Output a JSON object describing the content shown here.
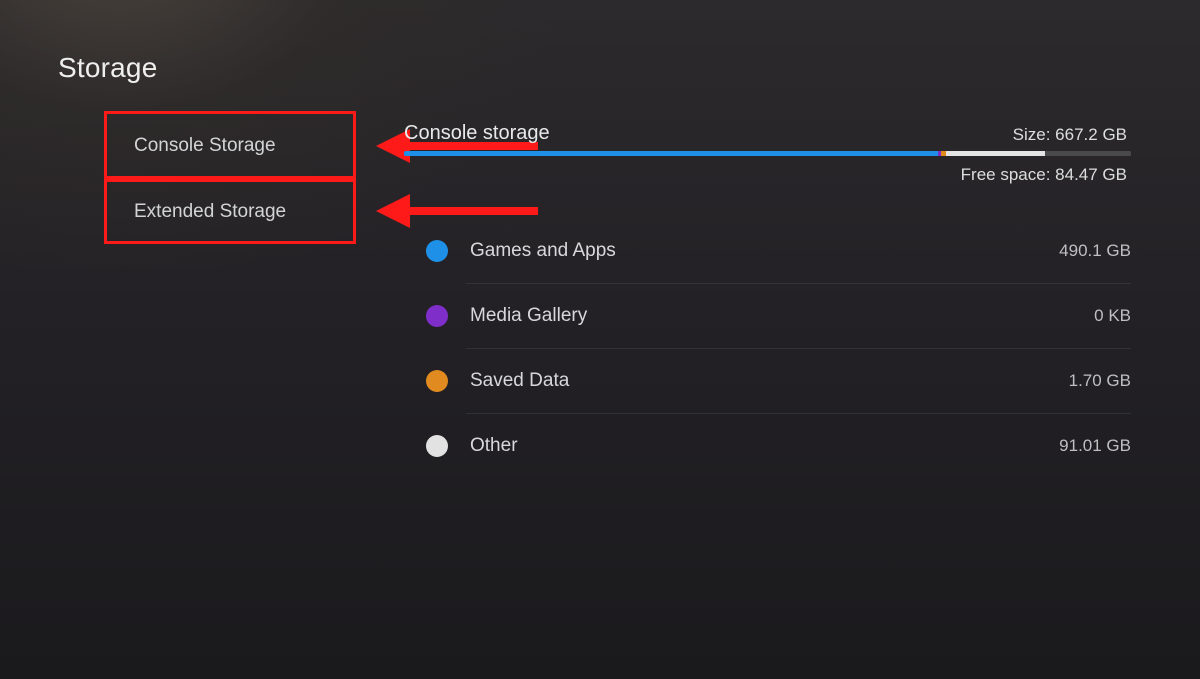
{
  "title": "Storage",
  "menu": {
    "console": "Console Storage",
    "extended": "Extended Storage"
  },
  "pane": {
    "heading": "Console storage",
    "size_label": "Size: 667.2 GB",
    "free_label": "Free space: 84.47 GB"
  },
  "bar": {
    "games_pct": 73.5,
    "media_pct": 0.3,
    "saved_pct": 0.8,
    "other_pct": 13.6,
    "free_pct": 11.8
  },
  "categories": {
    "games": {
      "label": "Games and Apps",
      "value": "490.1 GB"
    },
    "media": {
      "label": "Media Gallery",
      "value": "0 KB"
    },
    "saved": {
      "label": "Saved Data",
      "value": "1.70 GB"
    },
    "other": {
      "label": "Other",
      "value": "91.01 GB"
    }
  },
  "colors": {
    "games": "#1e90e8",
    "media": "#7f2ec9",
    "saved": "#e08a1f",
    "other": "#e4e4e4",
    "annotation": "#ff1a1a"
  }
}
